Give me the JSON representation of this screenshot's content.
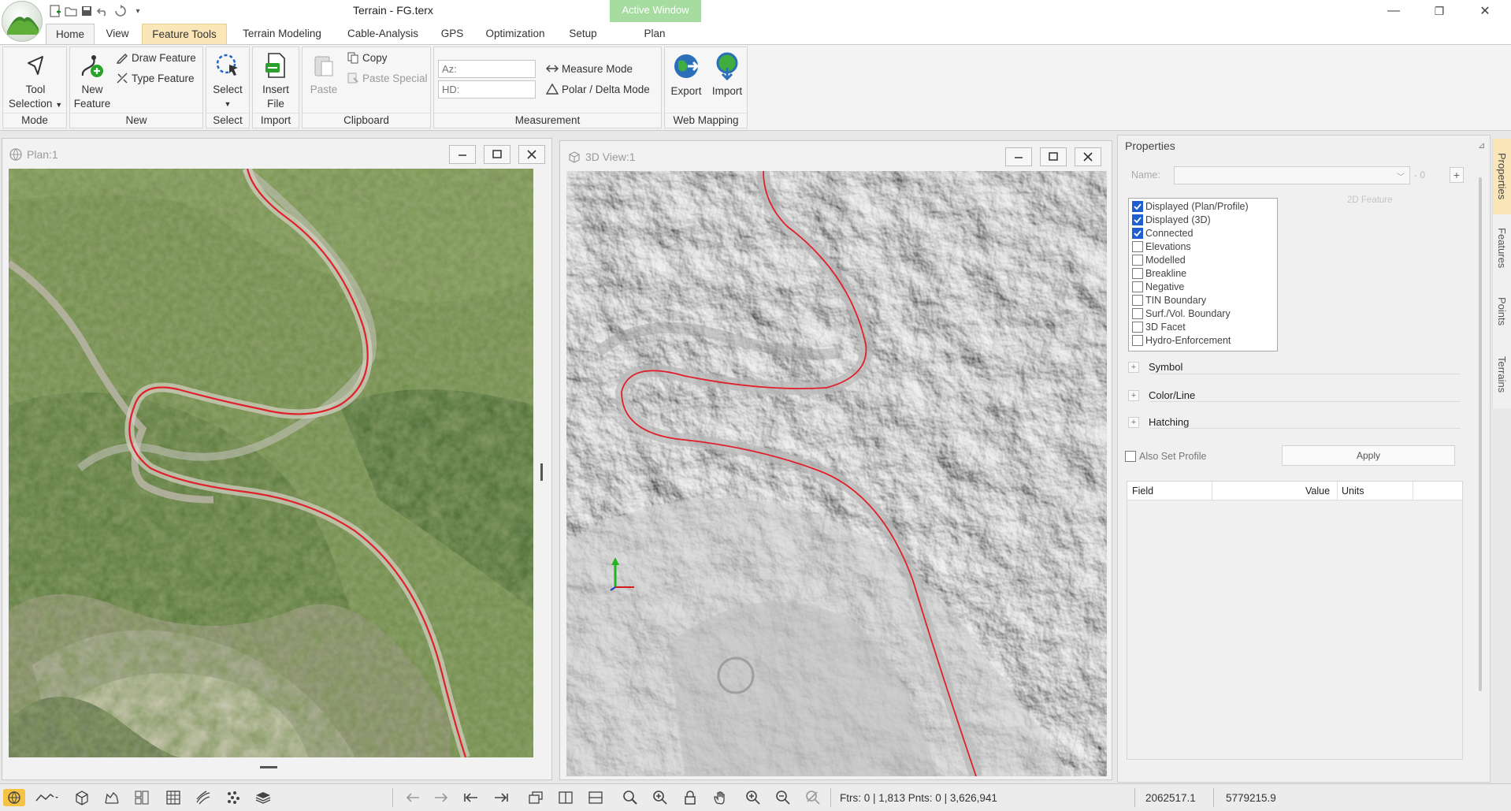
{
  "window": {
    "title": "Terrain - FG.terx",
    "active_window_label": "Active Window",
    "minimize": "—",
    "restore": "❐",
    "close": "✕"
  },
  "tabs": [
    "Home",
    "View",
    "Feature Tools",
    "Terrain Modeling",
    "Cable-Analysis",
    "GPS",
    "Optimization",
    "Setup",
    "Plan"
  ],
  "ribbon": {
    "mode": {
      "tool_selection_line1": "Tool",
      "tool_selection_line2": "Selection",
      "group": "Mode"
    },
    "new": {
      "new_feature_line1": "New",
      "new_feature_line2": "Feature",
      "draw_feature": "Draw Feature",
      "type_feature": "Type Feature",
      "group": "New"
    },
    "select": {
      "select": "Select",
      "group": "Select"
    },
    "import": {
      "insert_file_line1": "Insert",
      "insert_file_line2": "File",
      "group": "Import"
    },
    "clipboard": {
      "paste": "Paste",
      "copy": "Copy",
      "paste_special": "Paste Special",
      "group": "Clipboard"
    },
    "measurement": {
      "az_placeholder": "Az:",
      "hd_placeholder": "HD:",
      "measure_mode": "Measure Mode",
      "polar_delta_mode": "Polar / Delta Mode",
      "group": "Measurement"
    },
    "web_mapping": {
      "export": "Export",
      "import": "Import",
      "group": "Web Mapping"
    }
  },
  "plan_window": {
    "title": "Plan:1"
  },
  "view3d_window": {
    "title": "3D View:1"
  },
  "properties": {
    "title": "Properties",
    "name_label": "Name:",
    "name_suffix": "- 0",
    "feature_type": "2D Feature",
    "flags": [
      {
        "label": "Displayed (Plan/Profile)",
        "checked": true
      },
      {
        "label": "Displayed (3D)",
        "checked": true
      },
      {
        "label": "Connected",
        "checked": true
      },
      {
        "label": "Elevations",
        "checked": false
      },
      {
        "label": "Modelled",
        "checked": false
      },
      {
        "label": "Breakline",
        "checked": false
      },
      {
        "label": "Negative",
        "checked": false
      },
      {
        "label": "TIN Boundary",
        "checked": false
      },
      {
        "label": "Surf./Vol. Boundary",
        "checked": false
      },
      {
        "label": "3D Facet",
        "checked": false
      },
      {
        "label": "Hydro-Enforcement",
        "checked": false
      }
    ],
    "sections": [
      "Symbol",
      "Color/Line",
      "Hatching"
    ],
    "also_set_profile": "Also Set Profile",
    "apply": "Apply",
    "grid_headers": {
      "field": "Field",
      "value": "Value",
      "units": "Units"
    }
  },
  "side_tabs": [
    "Properties",
    "Features",
    "Points",
    "Terrains"
  ],
  "status": {
    "features_text": "Ftrs: 0 | 1,813  Pnts: 0 | 3,626,941",
    "easting": "2062517.1",
    "northing": "5779215.9"
  },
  "colors": {
    "road": "#e0202a",
    "accent_tab": "#fbe6b8",
    "checkbox": "#1e5fd0"
  }
}
